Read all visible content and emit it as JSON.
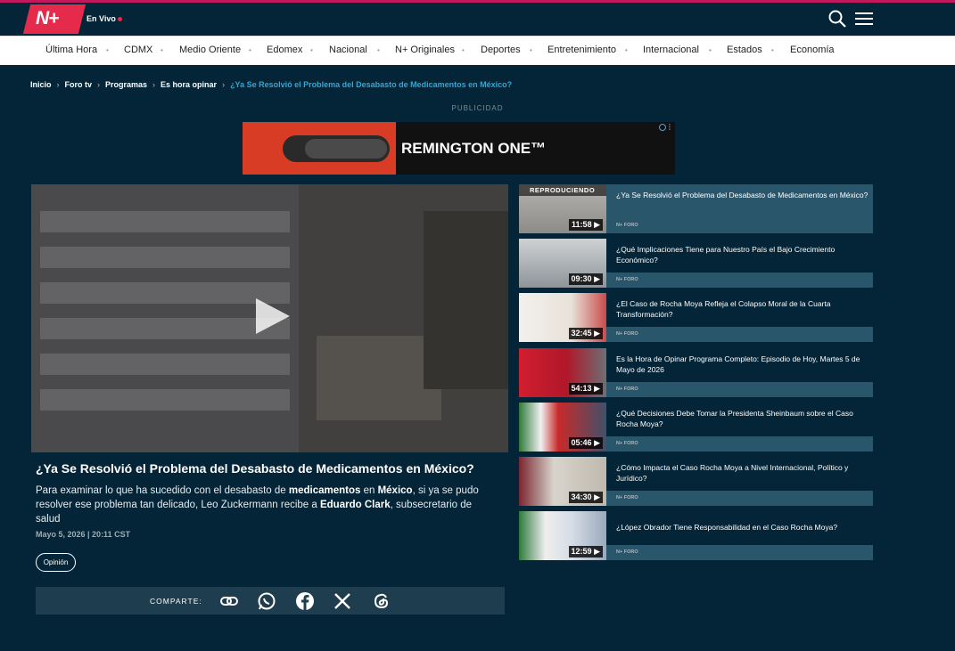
{
  "header": {
    "logo_text": "N+",
    "live_label": "En Vivo"
  },
  "nav": {
    "items": [
      "Última Hora",
      "CDMX",
      "Medio Oriente",
      "Edomex",
      "Nacional",
      "N+ Originales",
      "Deportes",
      "Entretenimiento",
      "Internacional",
      "Estados",
      "Economía"
    ]
  },
  "breadcrumb": {
    "items": [
      "Inicio",
      "Foro tv",
      "Programas",
      "Es hora opinar"
    ],
    "current": "¿Ya Se Resolvió el Problema del Desabasto de Medicamentos en México?"
  },
  "ad": {
    "label": "PUBLICIDAD",
    "brand_text": "REMINGTON ONE™"
  },
  "article": {
    "title": "¿Ya Se Resolvió el Problema del Desabasto de Medicamentos en México?",
    "desc_1": "Para examinar lo que ha sucedido con el desabasto de ",
    "desc_b1": "medicamentos",
    "desc_2": " en ",
    "desc_b2": "México",
    "desc_3": ", si ya se pudo resolver ese problema tan delicado, Leo Zuckermann recibe a ",
    "desc_b3": "Eduardo Clark",
    "desc_4": ", subsecretario de salud",
    "date": "Mayo 5, 2026 | 20:11 CST",
    "tag": "Opinión"
  },
  "share": {
    "label": "COMPARTE:"
  },
  "playlist": {
    "badge": "REPRODUCIENDO",
    "items": [
      {
        "title": "¿Ya Se Resolvió el Problema del Desabasto de Medicamentos en México?",
        "duration": "11:58 ▶",
        "source": "N+ FORO"
      },
      {
        "title": "¿Qué Implicaciones Tiene para Nuestro País el Bajo Crecimiento Económico?",
        "duration": "09:30 ▶",
        "source": "N+ FORO"
      },
      {
        "title": "¿El Caso de Rocha Moya Refleja el Colapso Moral de la Cuarta Transformación?",
        "duration": "32:45 ▶",
        "source": "N+ FORO"
      },
      {
        "title": "Es la Hora de Opinar Programa Completo: Episodio de Hoy, Martes 5 de Mayo de 2026",
        "duration": "54:13 ▶",
        "source": "N+ FORO"
      },
      {
        "title": "¿Qué Decisiones Debe Tomar la Presidenta Sheinbaum sobre el Caso Rocha Moya?",
        "duration": "05:46 ▶",
        "source": "N+ FORO"
      },
      {
        "title": "¿Cómo Impacta el Caso Rocha Moya a Nivel Internacional, Político y Jurídico?",
        "duration": "34:30 ▶",
        "source": "N+ FORO"
      },
      {
        "title": "¿López Obrador Tiene Responsabilidad en el Caso Rocha Moya?",
        "duration": "12:59 ▶",
        "source": "N+ FORO"
      }
    ]
  },
  "colors": {
    "background": "#032537",
    "accent": "#e62a4b",
    "link": "#2ea8d6",
    "panel": "#2a566b"
  }
}
